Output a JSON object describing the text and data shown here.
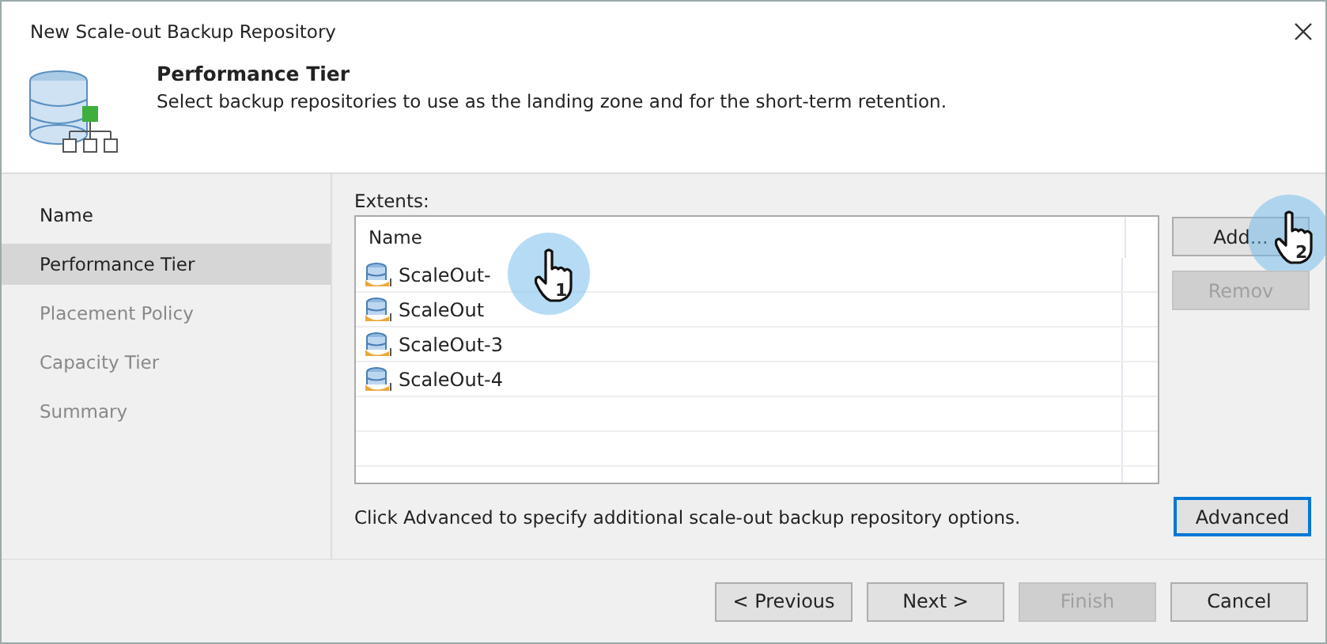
{
  "window": {
    "title": "New Scale-out Backup Repository"
  },
  "header": {
    "title": "Performance Tier",
    "description": "Select backup repositories to use as the landing zone and for the short-term retention."
  },
  "steps": [
    {
      "label": "Name",
      "selected": false
    },
    {
      "label": "Performance Tier",
      "selected": true
    },
    {
      "label": "Placement Policy",
      "selected": false
    },
    {
      "label": "Capacity Tier",
      "selected": false
    },
    {
      "label": "Summary",
      "selected": false
    }
  ],
  "extents": {
    "label": "Extents:",
    "columns": [
      "Name"
    ],
    "rows": [
      {
        "name": "ScaleOut-",
        "click_marker": "1"
      },
      {
        "name": "ScaleOut"
      },
      {
        "name": "ScaleOut-3"
      },
      {
        "name": "ScaleOut-4"
      }
    ]
  },
  "side_buttons": [
    {
      "label": "Add...",
      "disabled": false,
      "click_marker": "2"
    },
    {
      "label": "Remov",
      "disabled": true
    }
  ],
  "hint": "Click Advanced to specify additional scale-out backup repository options.",
  "advanced_button": {
    "label": "Advanced",
    "focused": true
  },
  "footer_buttons": [
    {
      "label": "< Previous",
      "disabled": false
    },
    {
      "label": "Next >",
      "disabled": false
    },
    {
      "label": "Finish",
      "disabled": true
    },
    {
      "label": "Cancel",
      "disabled": false
    }
  ]
}
